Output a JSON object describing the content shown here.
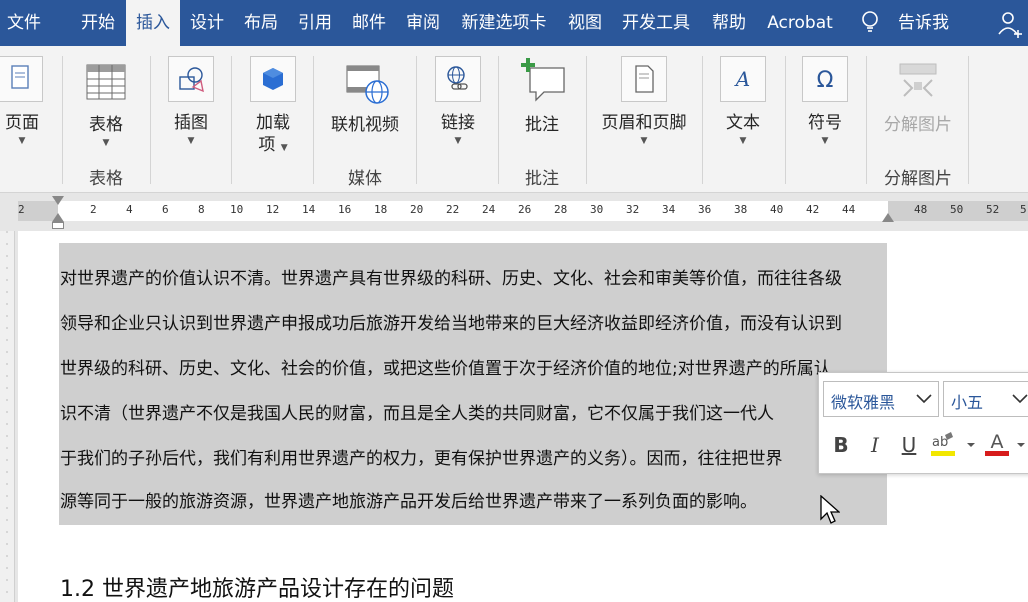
{
  "tabs": [
    {
      "label": "文件",
      "active": false
    },
    {
      "label": "开始",
      "active": false
    },
    {
      "label": "插入",
      "active": true
    },
    {
      "label": "设计",
      "active": false
    },
    {
      "label": "布局",
      "active": false
    },
    {
      "label": "引用",
      "active": false
    },
    {
      "label": "邮件",
      "active": false
    },
    {
      "label": "审阅",
      "active": false
    },
    {
      "label": "新建选项卡",
      "active": false
    },
    {
      "label": "视图",
      "active": false
    },
    {
      "label": "开发工具",
      "active": false
    },
    {
      "label": "帮助",
      "active": false
    },
    {
      "label": "Acrobat",
      "active": false
    }
  ],
  "tellme": "告诉我",
  "ribbon": {
    "buttons": {
      "pages": "页面",
      "table": "表格",
      "illustrations": "插图",
      "addins_line1": "加载",
      "addins_line2": "项",
      "online_video": "联机视频",
      "link": "链接",
      "comment": "批注",
      "header_footer": "页眉和页脚",
      "text": "文本",
      "symbols": "符号",
      "split_image": "分解图片"
    },
    "groups": {
      "tables": "表格",
      "media": "媒体",
      "comments": "批注",
      "split_image": "分解图片"
    }
  },
  "ruler_numbers": [
    "2",
    "2",
    "4",
    "6",
    "8",
    "10",
    "12",
    "14",
    "16",
    "18",
    "20",
    "22",
    "24",
    "26",
    "28",
    "30",
    "32",
    "34",
    "36",
    "38",
    "40",
    "42",
    "44",
    "48",
    "50",
    "52",
    "5"
  ],
  "document": {
    "lines": [
      "对世界遗产的价值认识不清。世界遗产具有世界级的科研、历史、文化、社会和审美等价值，而往往各级",
      "领导和企业只认识到世界遗产申报成功后旅游开发给当地带来的巨大经济收益即经济价值，而没有认识到",
      "世界级的科研、历史、文化、社会的价值，或把这些价值置于次于经济价值的地位;对世界遗产的所属认",
      "识不清（世界遗产不仅是我国人民的财富，而且是全人类的共同财富，它不仅属于我们这一代人",
      "于我们的子孙后代，我们有利用世界遗产的权力，更有保护世界遗产的义务）。因而，往往把世界",
      "源等同于一般的旅游资源，世界遗产地旅游产品开发后给世界遗产带来了一系列负面的影响。"
    ],
    "heading": "1.2  世界遗产地旅游产品设计存在的问题"
  },
  "mini_toolbar": {
    "font": "微软雅黑",
    "size": "小五",
    "bold": "B",
    "italic": "I",
    "underline": "U",
    "highlight_color": "#f2e700",
    "font_color": "#d71c1c"
  },
  "colors": {
    "accent": "#2b579a",
    "selection": "#cfcfcf"
  }
}
